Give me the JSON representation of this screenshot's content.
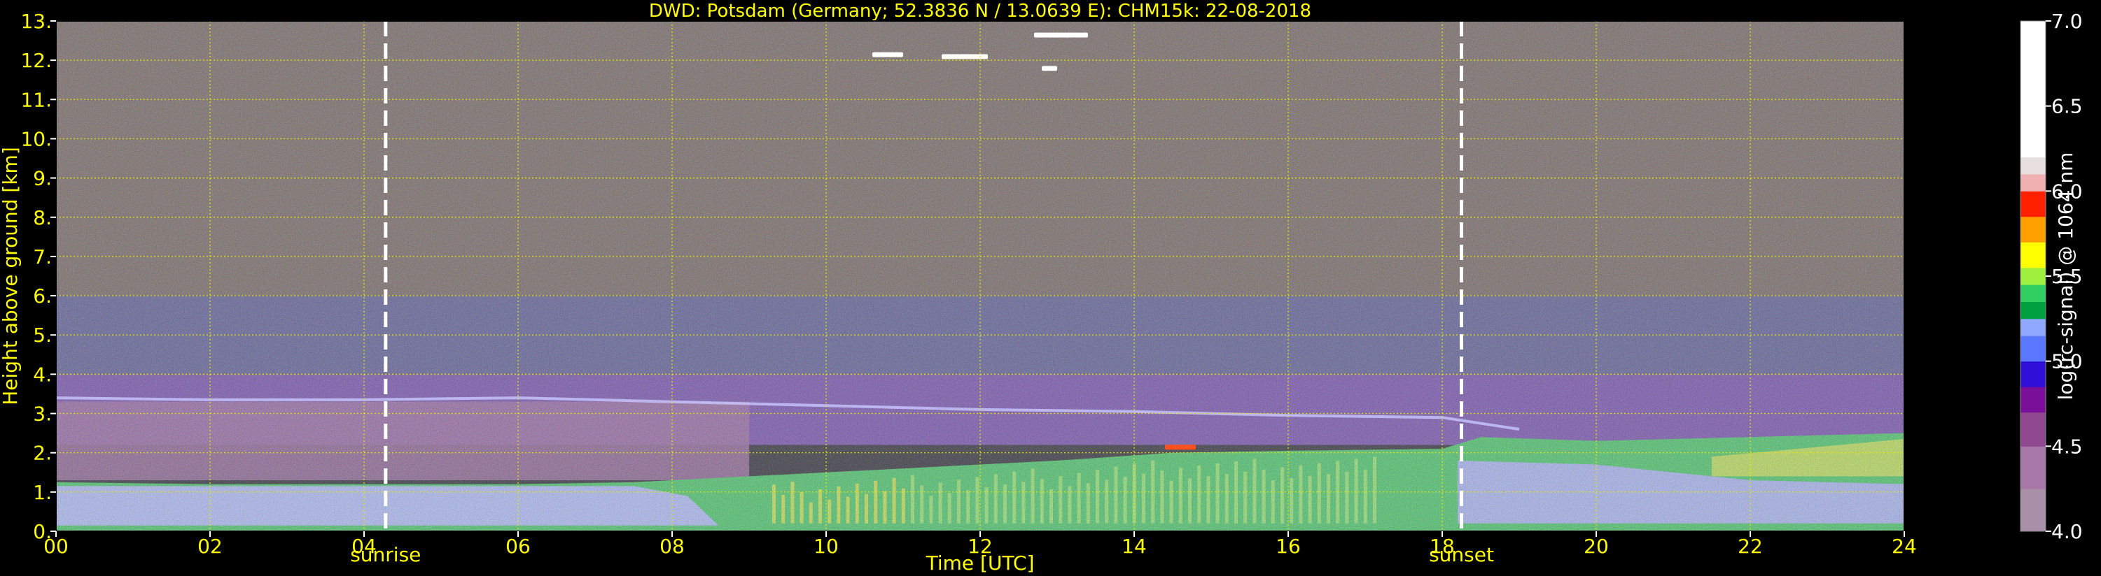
{
  "chart_data": {
    "type": "heatmap",
    "title": "DWD: Potsdam (Germany; 52.3836 N / 13.0639 E):    CHM15k: 22-08-2018",
    "xlabel": "Time [UTC]",
    "ylabel": "Height above ground [km]",
    "xlim": [
      0,
      24
    ],
    "ylim": [
      0,
      13
    ],
    "x_ticks": [
      "00",
      "02",
      "04",
      "06",
      "08",
      "10",
      "12",
      "14",
      "16",
      "18",
      "20",
      "22",
      "24"
    ],
    "y_ticks": [
      "0.",
      "1.",
      "2.",
      "3.",
      "4.",
      "5.",
      "6.",
      "7.",
      "8.",
      "9.",
      "10.",
      "11.",
      "12.",
      "13."
    ],
    "grid": true,
    "events": [
      {
        "name": "sunrise",
        "time": 4.28
      },
      {
        "name": "sunset",
        "time": 18.25
      }
    ],
    "colorbar": {
      "label": "log(rc-signal) @ 1064 nm",
      "range": [
        4.0,
        7.0
      ],
      "ticks": [
        "4.0",
        "4.5",
        "5.0",
        "5.5",
        "6.0",
        "6.5",
        "7.0"
      ],
      "stops": [
        {
          "v": 4.0,
          "color": "#a890a8"
        },
        {
          "v": 4.25,
          "color": "#a878a8"
        },
        {
          "v": 4.5,
          "color": "#904890"
        },
        {
          "v": 4.7,
          "color": "#7a0f9a"
        },
        {
          "v": 4.85,
          "color": "#3010d8"
        },
        {
          "v": 5.0,
          "color": "#5a78ff"
        },
        {
          "v": 5.15,
          "color": "#90a8ff"
        },
        {
          "v": 5.25,
          "color": "#00a040"
        },
        {
          "v": 5.35,
          "color": "#30d060"
        },
        {
          "v": 5.45,
          "color": "#a0f040"
        },
        {
          "v": 5.55,
          "color": "#ffff00"
        },
        {
          "v": 5.7,
          "color": "#ffa000"
        },
        {
          "v": 5.85,
          "color": "#ff2000"
        },
        {
          "v": 6.0,
          "color": "#f0b0b0"
        },
        {
          "v": 6.1,
          "color": "#e8e0e0"
        },
        {
          "v": 6.2,
          "color": "#ffffff"
        },
        {
          "v": 7.0,
          "color": "#ffffff"
        }
      ]
    },
    "features": {
      "boundary_layer_top_km": [
        {
          "t": 0,
          "h": 1.25
        },
        {
          "t": 2,
          "h": 1.2
        },
        {
          "t": 4,
          "h": 1.2
        },
        {
          "t": 6,
          "h": 1.2
        },
        {
          "t": 7.5,
          "h": 1.25
        },
        {
          "t": 9,
          "h": 1.4
        },
        {
          "t": 11,
          "h": 1.6
        },
        {
          "t": 13,
          "h": 1.8
        },
        {
          "t": 14.5,
          "h": 2.0
        },
        {
          "t": 16,
          "h": 2.05
        },
        {
          "t": 18,
          "h": 2.1
        },
        {
          "t": 18.5,
          "h": 2.4
        },
        {
          "t": 20,
          "h": 2.3
        },
        {
          "t": 22,
          "h": 2.4
        },
        {
          "t": 24,
          "h": 2.5
        }
      ],
      "residual_layer_km": [
        {
          "t": 0,
          "h": 3.4
        },
        {
          "t": 2,
          "h": 3.35
        },
        {
          "t": 4,
          "h": 3.35
        },
        {
          "t": 6,
          "h": 3.4
        },
        {
          "t": 8,
          "h": 3.3
        },
        {
          "t": 10,
          "h": 3.2
        },
        {
          "t": 12,
          "h": 3.1
        },
        {
          "t": 14,
          "h": 3.05
        },
        {
          "t": 16,
          "h": 2.95
        },
        {
          "t": 18,
          "h": 2.9
        },
        {
          "t": 19,
          "h": 2.6
        }
      ],
      "cloud_patches": [
        {
          "t0": 10.6,
          "t1": 11.0,
          "h": 12.15
        },
        {
          "t0": 11.5,
          "t1": 12.1,
          "h": 12.1
        },
        {
          "t0": 12.7,
          "t1": 13.4,
          "h": 12.65
        },
        {
          "t0": 12.8,
          "t1": 13.0,
          "h": 11.8
        },
        {
          "t0": 14.4,
          "t1": 14.8,
          "h": 2.15
        }
      ]
    }
  }
}
